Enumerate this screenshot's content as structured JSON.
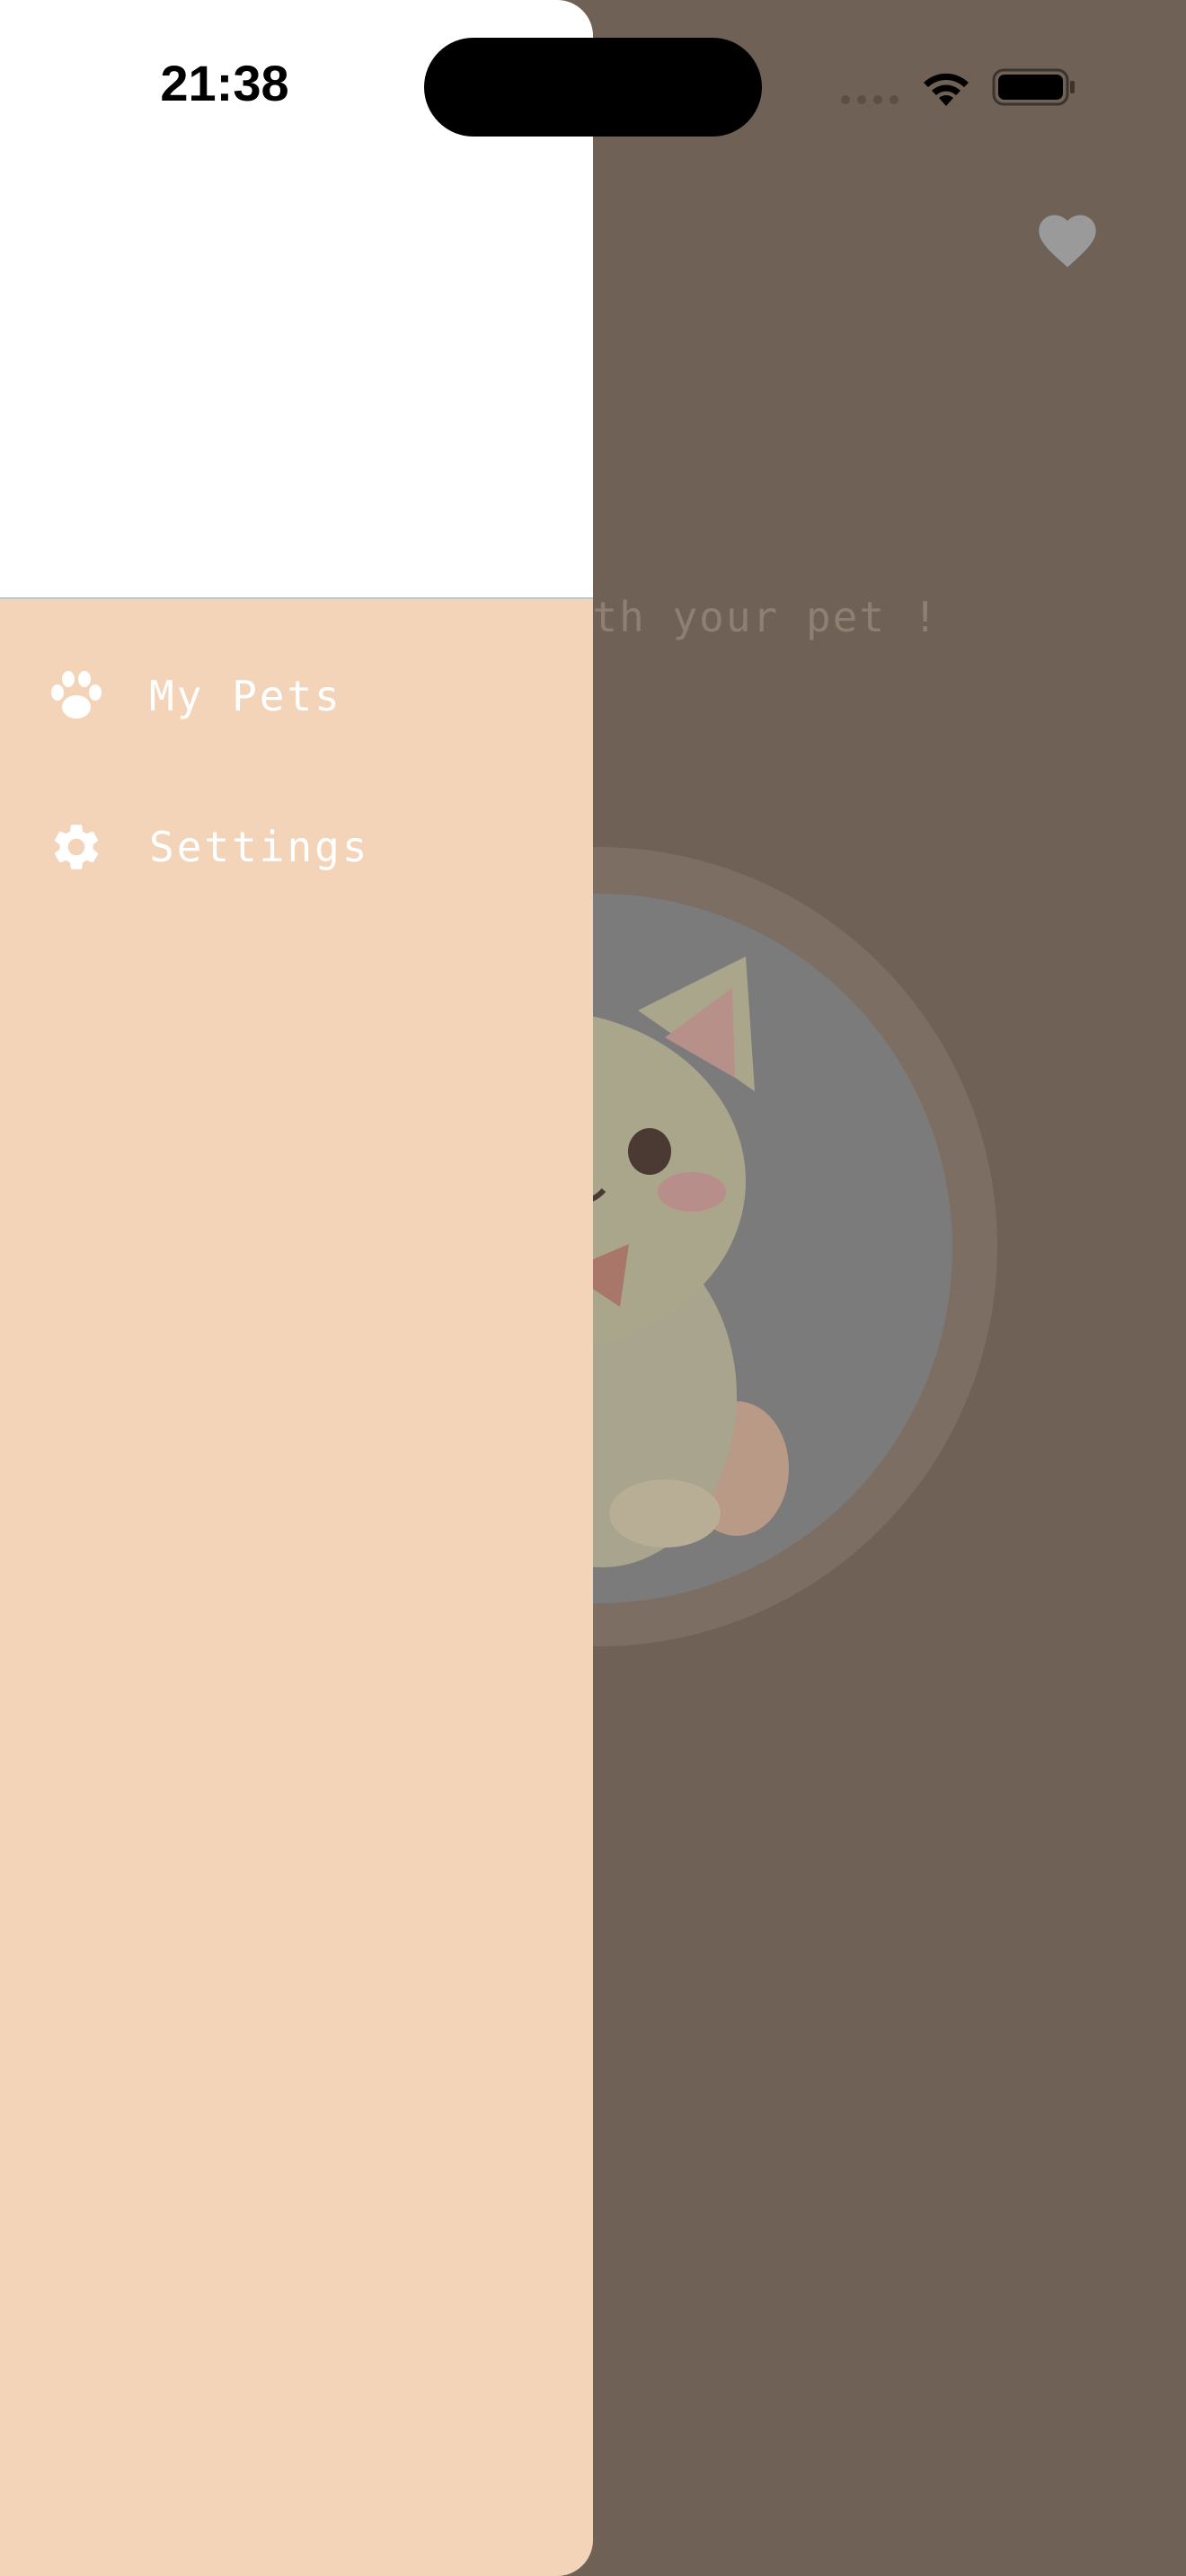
{
  "status_bar": {
    "time": "21:38",
    "icons": [
      "cellular-signal-icon",
      "wifi-icon",
      "battery-icon"
    ]
  },
  "background_screen": {
    "subtitle_visible": "with your pet !",
    "favorite_icon": "heart-icon",
    "pet_image": "cat-avatar"
  },
  "drawer": {
    "items": [
      {
        "label": "My Pets",
        "icon": "paw-icon"
      },
      {
        "label": "Settings",
        "icon": "gear-icon"
      }
    ]
  },
  "colors": {
    "drawer_bg": "#f3d4b8",
    "drawer_header_bg": "#ffffff",
    "scrim_bg": "#6f6155",
    "menu_text": "#ffffff"
  }
}
